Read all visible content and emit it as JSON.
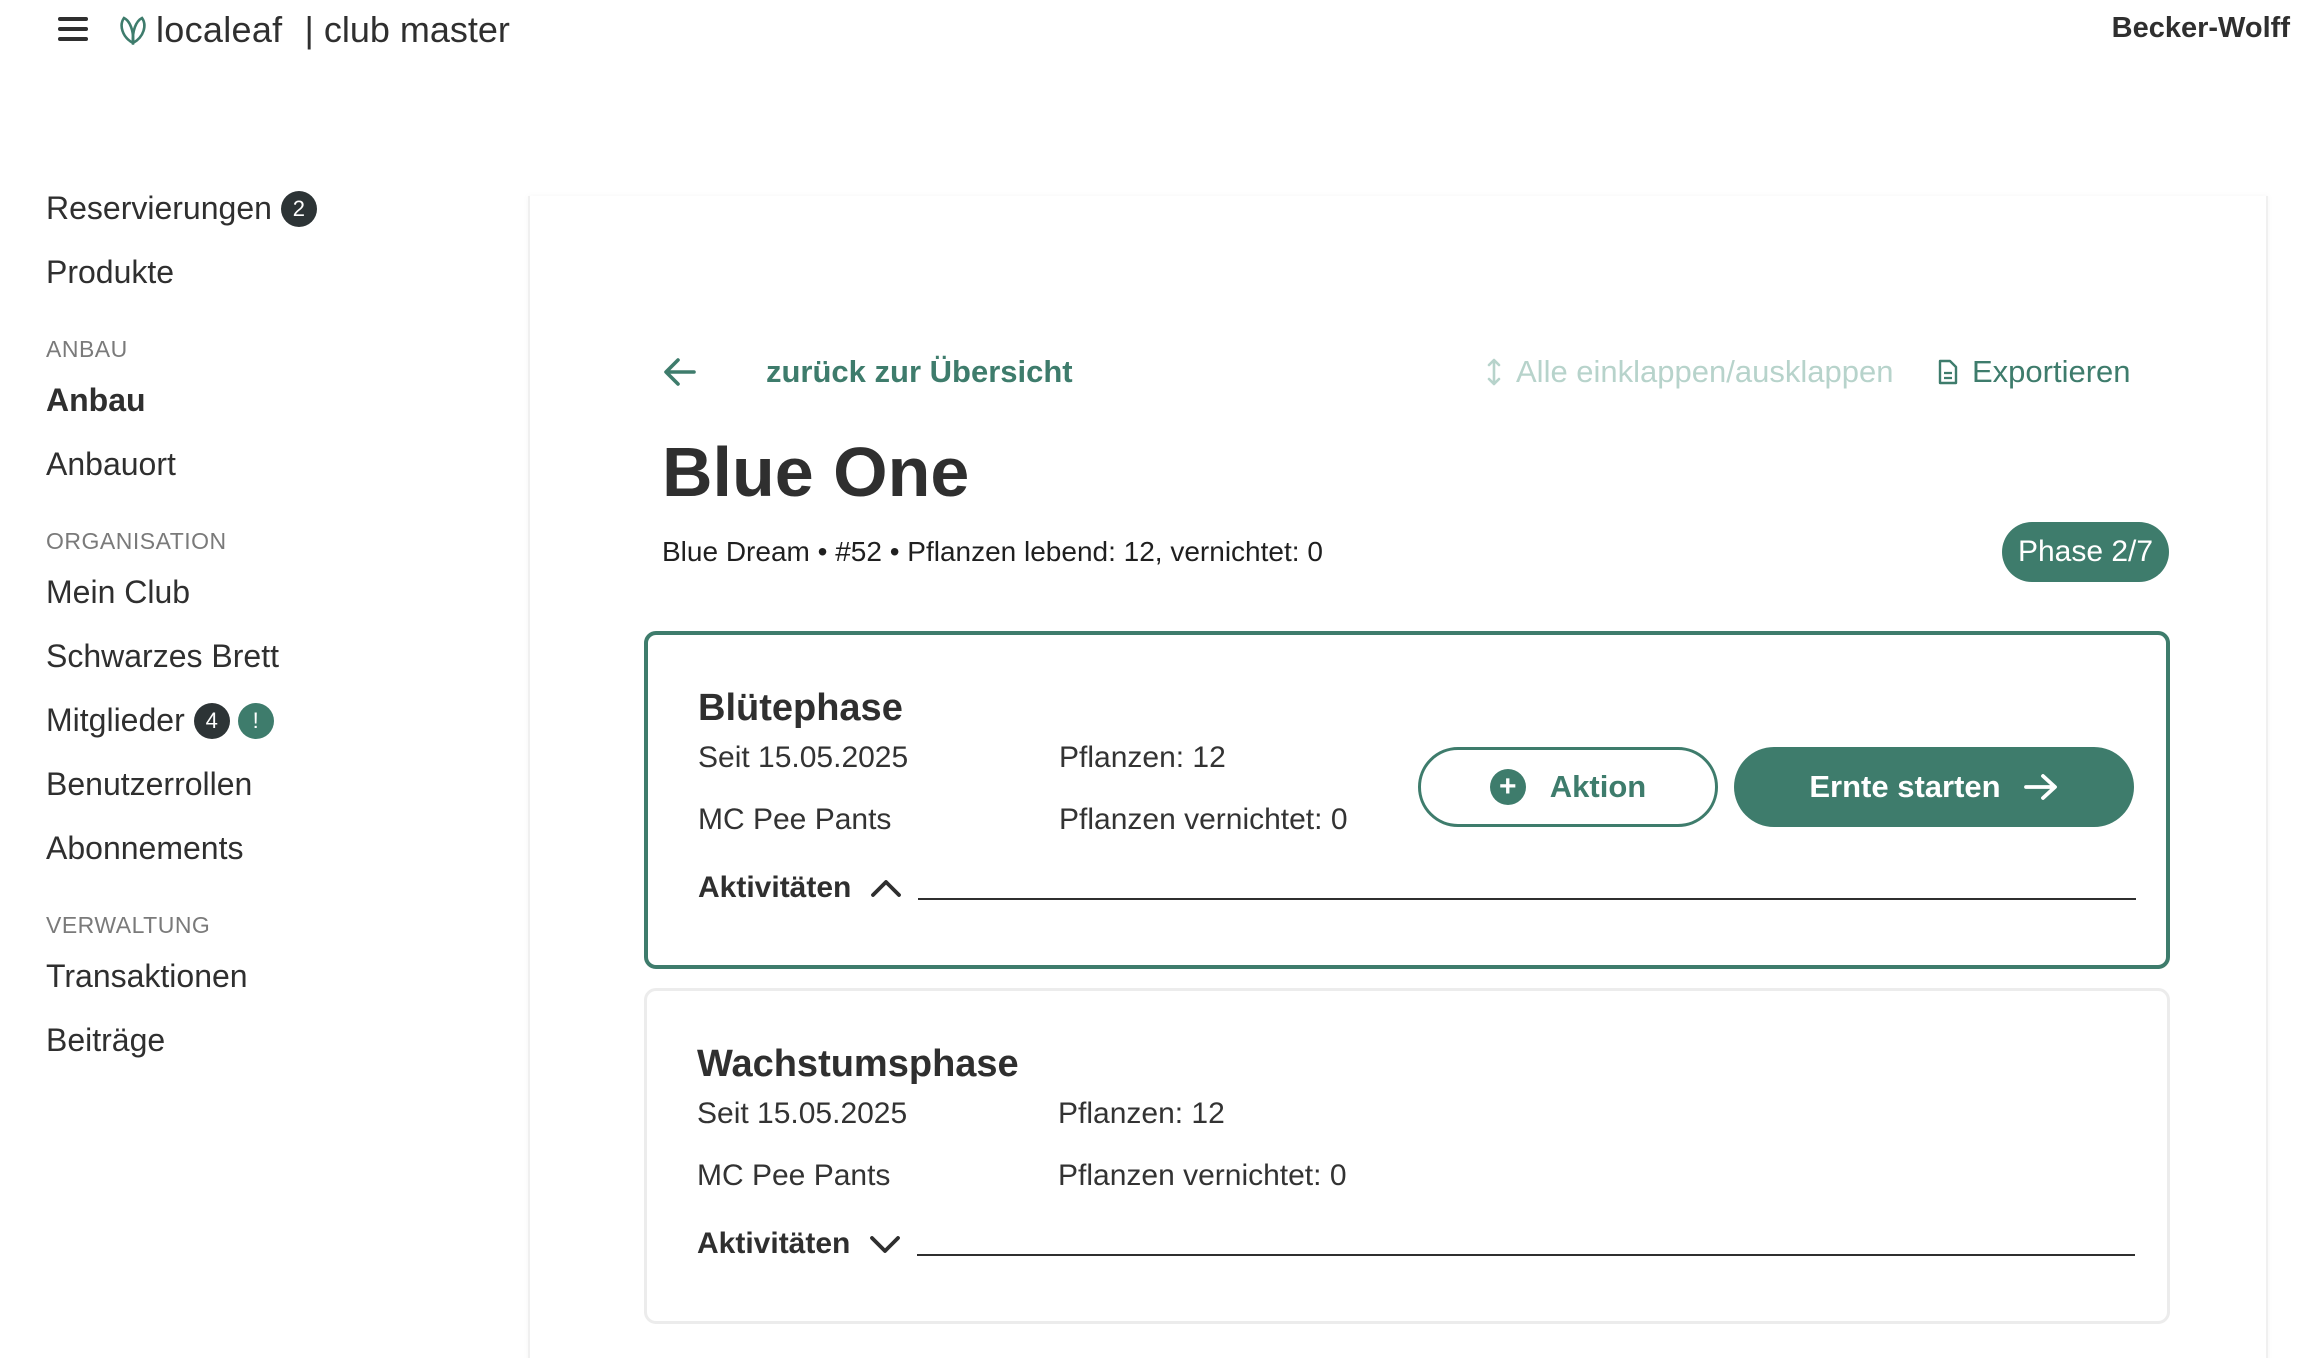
{
  "header": {
    "logo_text": "localeaf",
    "product_name": "| club master",
    "user_name": "Becker-Wolff"
  },
  "sidebar": {
    "items_top": [
      {
        "label": "Reservierungen",
        "badge": "2"
      },
      {
        "label": "Produkte"
      }
    ],
    "section_anbau": "ANBAU",
    "items_anbau": [
      {
        "label": "Anbau",
        "active": true
      },
      {
        "label": "Anbauort"
      }
    ],
    "section_organisation": "ORGANISATION",
    "items_organisation": [
      {
        "label": "Mein Club"
      },
      {
        "label": "Schwarzes Brett"
      },
      {
        "label": "Mitglieder",
        "badge": "4",
        "alert": "!"
      },
      {
        "label": "Benutzerrollen"
      },
      {
        "label": "Abonnements"
      }
    ],
    "section_verwaltung": "VERWALTUNG",
    "items_verwaltung": [
      {
        "label": "Transaktionen"
      },
      {
        "label": "Beiträge"
      }
    ]
  },
  "toolbar": {
    "back_label": "zurück zur Übersicht",
    "collapse_label": "Alle einklappen/ausklappen",
    "export_label": "Exportieren"
  },
  "grow": {
    "title": "Blue One",
    "subtitle": "Blue Dream • #52 • Pflanzen lebend: 12, vernichtet: 0",
    "phase": "Phase 2/7"
  },
  "phases": [
    {
      "name": "Blütephase",
      "since": "Seit 15.05.2025",
      "owner": "MC Pee Pants",
      "plants": "Pflanzen: 12",
      "destroyed": "Pflanzen vernichtet: 0",
      "activities_label": "Aktivitäten",
      "expanded": true,
      "action_label": "Aktion",
      "harvest_label": "Ernte starten"
    },
    {
      "name": "Wachstumsphase",
      "since": "Seit 15.05.2025",
      "owner": "MC Pee Pants",
      "plants": "Pflanzen: 12",
      "destroyed": "Pflanzen vernichtet: 0",
      "activities_label": "Aktivitäten",
      "expanded": false
    }
  ],
  "colors": {
    "accent": "#3e7c6c",
    "accent_light": "#b7d3cb",
    "text": "#2f2f2f",
    "badge_dark": "#2d3436"
  }
}
